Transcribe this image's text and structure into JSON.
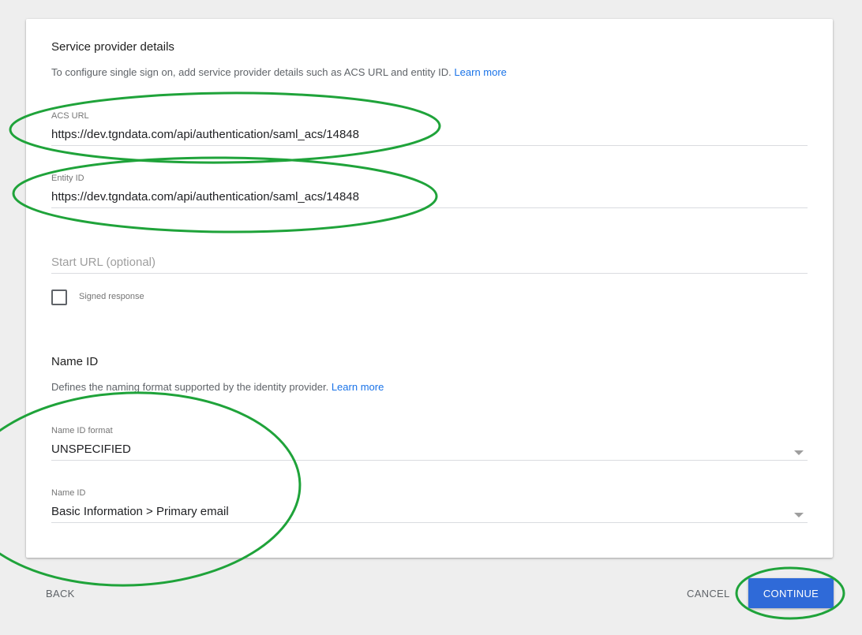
{
  "sp_details": {
    "title": "Service provider details",
    "description": "To configure single sign on, add service provider details such as ACS URL and entity ID.",
    "learn_more": "Learn more"
  },
  "acs_url": {
    "label": "ACS URL",
    "value": "https://dev.tgndata.com/api/authentication/saml_acs/14848"
  },
  "entity_id": {
    "label": "Entity ID",
    "value": "https://dev.tgndata.com/api/authentication/saml_acs/14848"
  },
  "start_url": {
    "placeholder": "Start URL (optional)"
  },
  "signed_response": {
    "label": "Signed response",
    "checked": false
  },
  "name_id_section": {
    "title": "Name ID",
    "description": "Defines the naming format supported by the identity provider.",
    "learn_more": "Learn more"
  },
  "name_id_format": {
    "label": "Name ID format",
    "value": "UNSPECIFIED",
    "icon": "chevron-down-icon"
  },
  "name_id": {
    "label": "Name ID",
    "value": "Basic Information > Primary email",
    "icon": "chevron-down-icon"
  },
  "footer": {
    "back_label": "BACK",
    "cancel_label": "CANCEL",
    "continue_label": "CONTINUE"
  },
  "colors": {
    "accent": "#2f6ad8",
    "link": "#1a73e8",
    "annotation": "#1fa33a"
  }
}
